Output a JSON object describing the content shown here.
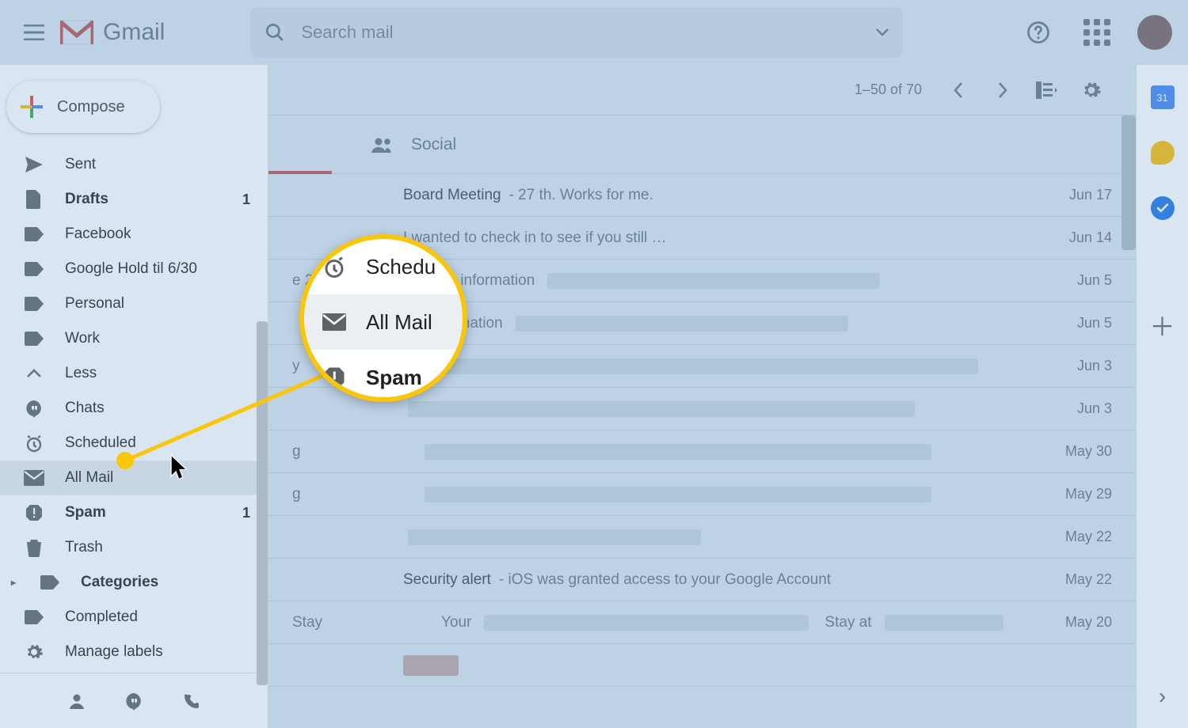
{
  "header": {
    "product": "Gmail",
    "search_placeholder": "Search mail"
  },
  "compose_label": "Compose",
  "sidebar": {
    "items": [
      {
        "label": "Sent",
        "icon": "send",
        "bold": false
      },
      {
        "label": "Drafts",
        "icon": "file",
        "bold": true,
        "count": "1"
      },
      {
        "label": "Facebook",
        "icon": "label",
        "bold": false
      },
      {
        "label": "Google Hold til 6/30",
        "icon": "label",
        "bold": false
      },
      {
        "label": "Personal",
        "icon": "label",
        "bold": false
      },
      {
        "label": "Work",
        "icon": "label",
        "bold": false
      },
      {
        "label": "Less",
        "icon": "chevron-up",
        "bold": false
      },
      {
        "label": "Chats",
        "icon": "chat",
        "bold": false
      },
      {
        "label": "Scheduled",
        "icon": "schedule",
        "bold": false
      },
      {
        "label": "All Mail",
        "icon": "mail",
        "bold": false,
        "selected": true
      },
      {
        "label": "Spam",
        "icon": "spam",
        "bold": true,
        "count": "1"
      },
      {
        "label": "Trash",
        "icon": "trash",
        "bold": false
      },
      {
        "label": "Categories",
        "icon": "label",
        "bold": true,
        "caret": true
      },
      {
        "label": "Completed",
        "icon": "label",
        "bold": false
      },
      {
        "label": "Manage labels",
        "icon": "gear",
        "bold": false
      }
    ]
  },
  "toolbar": {
    "pager": "1–50 of 70"
  },
  "tabs": {
    "social": "Social"
  },
  "callout": {
    "scheduled": "Schedu",
    "allmail": "All Mail",
    "spam": "Spam"
  },
  "rail": {
    "cal_day": "31"
  },
  "rows": [
    {
      "leading_text": "",
      "subject": "Board Meeting",
      "snippet": " - 27 th. Works for me.",
      "date": "Jun 17",
      "blurs": []
    },
    {
      "leading_text": "",
      "subject": "",
      "snippet": "I wanted to check in to see if you still …",
      "date": "Jun 14",
      "blurs": []
    },
    {
      "leading_text": "e 2",
      "subject": "",
      "snippet": "tact information",
      "date": "Jun 5",
      "blurs": [
        420
      ]
    },
    {
      "leading_text": "",
      "subject": "",
      "snippet": "act Information",
      "date": "Jun 5",
      "blurs": [
        420
      ]
    },
    {
      "leading_text": "y",
      "subject": "",
      "snippet": "",
      "date": "Jun 3",
      "blurs": [
        700
      ]
    },
    {
      "leading_text": "",
      "subject": "",
      "snippet": "",
      "date": "Jun 3",
      "blurs": [
        640
      ]
    },
    {
      "leading_text": "g",
      "subject": "",
      "snippet": "",
      "date": "May 30",
      "blurs": [
        640
      ]
    },
    {
      "leading_text": "g",
      "subject": "",
      "snippet": "",
      "date": "May 29",
      "blurs": [
        640
      ]
    },
    {
      "leading_text": "",
      "subject": "",
      "snippet": "",
      "date": "May 22",
      "blurs": [
        370
      ]
    },
    {
      "leading_text": "",
      "subject": "Security alert",
      "snippet": " - iOS was granted access to your Google Account",
      "date": "May 22",
      "blurs": []
    },
    {
      "leading_text": "Stay",
      "subject": "",
      "snippet": "Your",
      "date": "May 20",
      "trailing": "Stay at",
      "blurs": [
        410,
        150
      ]
    },
    {
      "leading_text": "",
      "subject": "",
      "snippet": "",
      "date": "",
      "red": true
    }
  ]
}
